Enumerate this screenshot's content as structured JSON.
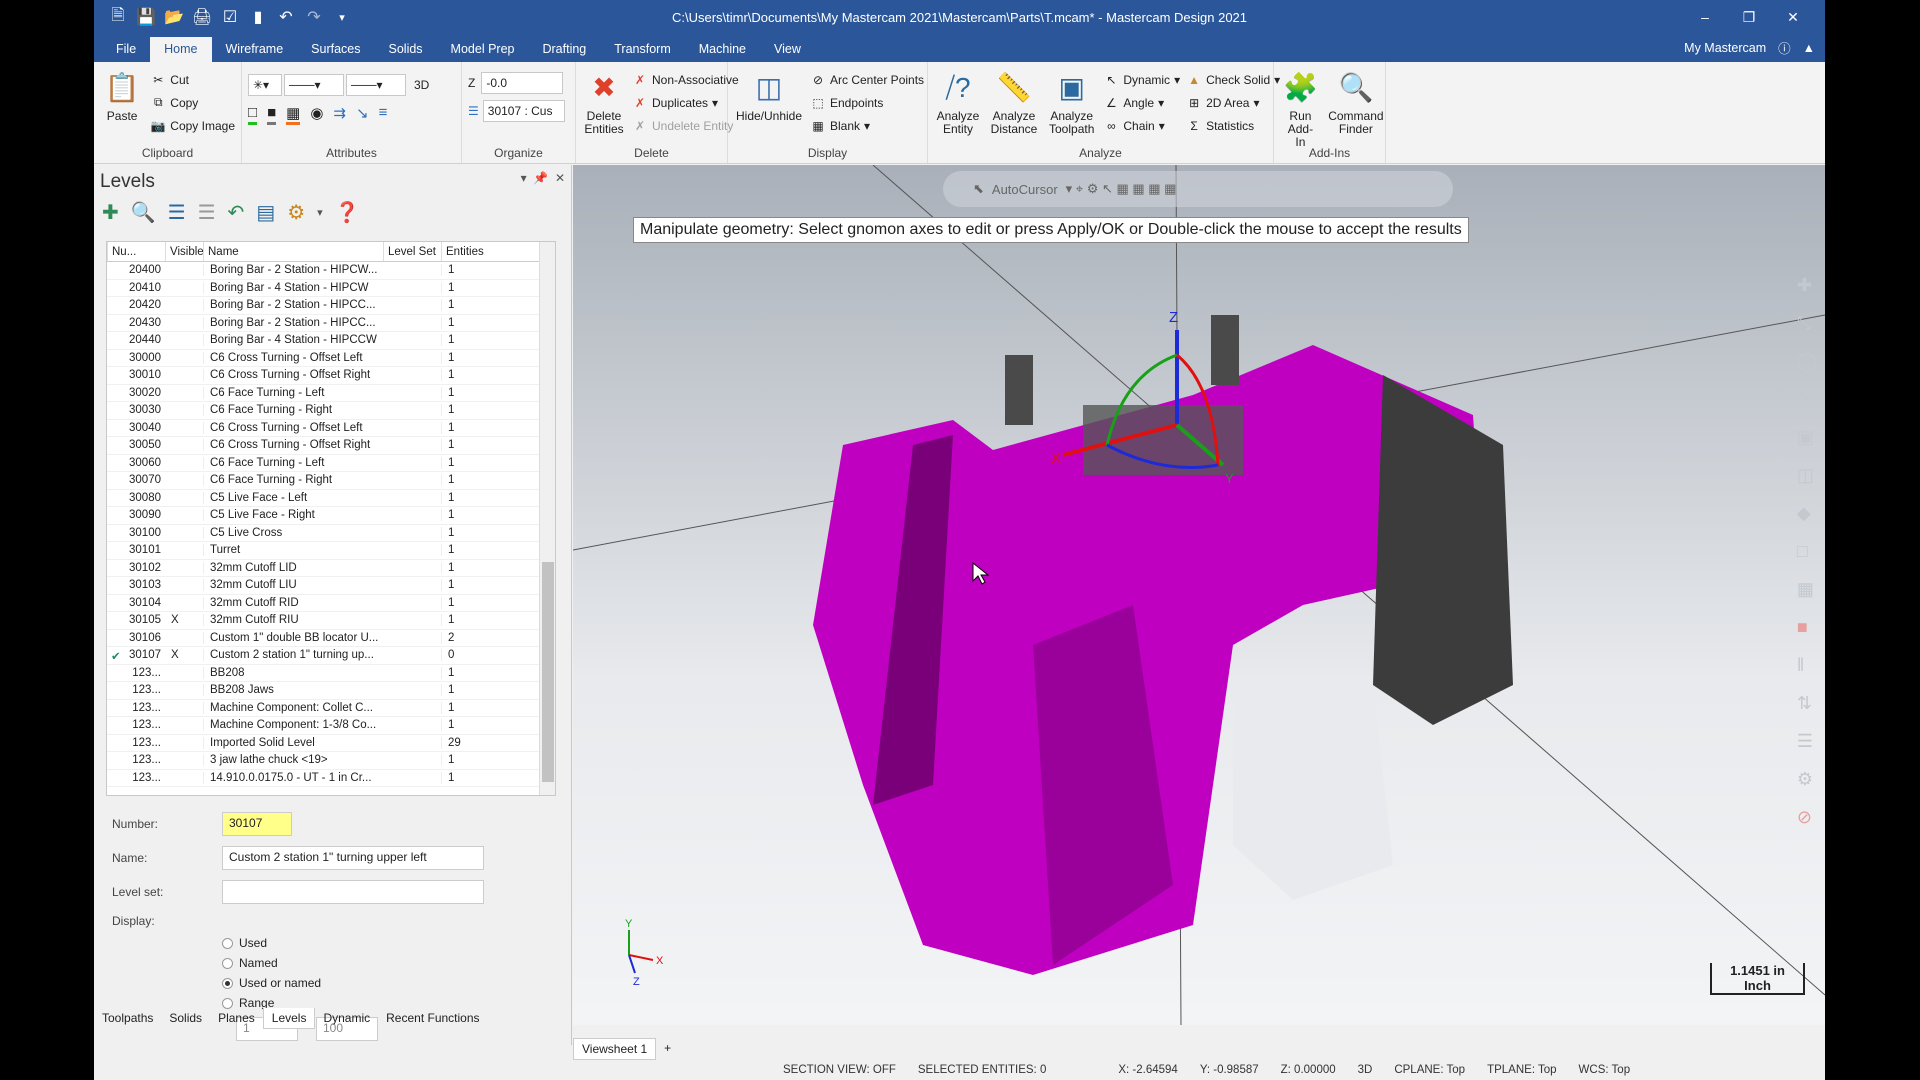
{
  "titlebar": {
    "title": "C:\\Users\\timr\\Documents\\My Mastercam 2021\\Mastercam\\Parts\\T.mcam* - Mastercam Design 2021",
    "qat_icons": [
      "new-file-icon",
      "save-icon",
      "open-icon",
      "print-icon",
      "save-as-icon",
      "bookmark-icon",
      "undo-icon",
      "redo-icon",
      "customize-icon"
    ],
    "controls": {
      "minimize": "–",
      "restore": "❐",
      "close": "✕"
    }
  },
  "tabs": [
    "File",
    "Home",
    "Wireframe",
    "Surfaces",
    "Solids",
    "Model Prep",
    "Drafting",
    "Transform",
    "Machine",
    "View"
  ],
  "active_tab": "Home",
  "my_mastercam": "My Mastercam",
  "ribbon": {
    "clipboard": {
      "label": "Clipboard",
      "paste": "Paste",
      "cut": "Cut",
      "copy": "Copy",
      "copy_image": "Copy Image"
    },
    "attributes": {
      "label": "Attributes",
      "mode": "3D"
    },
    "organize": {
      "label": "Organize",
      "z_label": "Z",
      "z_value": "-0.0",
      "level_value": "30107 : Cus"
    },
    "delete": {
      "label": "Delete",
      "delete_entities": "Delete Entities",
      "non_associative": "Non-Associative",
      "duplicates": "Duplicates",
      "undelete": "Undelete Entity"
    },
    "display": {
      "label": "Display",
      "hide_unhide": "Hide/Unhide",
      "arc_center": "Arc Center Points",
      "endpoints": "Endpoints",
      "blank": "Blank"
    },
    "analyze": {
      "label": "Analyze",
      "entity": "Analyze Entity",
      "distance": "Analyze Distance",
      "toolpath": "Analyze Toolpath",
      "dynamic": "Dynamic",
      "angle": "Angle",
      "chain": "Chain",
      "check_solid": "Check Solid",
      "area2d": "2D Area",
      "statistics": "Statistics"
    },
    "addins": {
      "label": "Add-Ins",
      "run": "Run Add-In",
      "finder": "Command Finder"
    }
  },
  "levels": {
    "title": "Levels",
    "columns": [
      "Nu...",
      "Visible",
      "Name",
      "Level Set",
      "Entities"
    ],
    "rows": [
      {
        "num": "20400",
        "vis": "",
        "name": "Boring Bar - 2 Station - HIPCW...",
        "ent": "1"
      },
      {
        "num": "20410",
        "vis": "",
        "name": "Boring Bar - 4 Station - HIPCW",
        "ent": "1"
      },
      {
        "num": "20420",
        "vis": "",
        "name": "Boring Bar - 2 Station - HIPCC...",
        "ent": "1"
      },
      {
        "num": "20430",
        "vis": "",
        "name": "Boring Bar - 2 Station - HIPCC...",
        "ent": "1"
      },
      {
        "num": "20440",
        "vis": "",
        "name": "Boring Bar - 4 Station - HIPCCW",
        "ent": "1"
      },
      {
        "num": "30000",
        "vis": "",
        "name": "C6 Cross Turning - Offset Left",
        "ent": "1"
      },
      {
        "num": "30010",
        "vis": "",
        "name": "C6 Cross Turning - Offset Right",
        "ent": "1"
      },
      {
        "num": "30020",
        "vis": "",
        "name": "C6 Face Turning - Left",
        "ent": "1"
      },
      {
        "num": "30030",
        "vis": "",
        "name": "C6 Face Turning - Right",
        "ent": "1"
      },
      {
        "num": "30040",
        "vis": "",
        "name": "C6 Cross Turning - Offset Left",
        "ent": "1"
      },
      {
        "num": "30050",
        "vis": "",
        "name": "C6 Cross Turning - Offset Right",
        "ent": "1"
      },
      {
        "num": "30060",
        "vis": "",
        "name": "C6 Face Turning - Left",
        "ent": "1"
      },
      {
        "num": "30070",
        "vis": "",
        "name": "C6 Face Turning - Right",
        "ent": "1"
      },
      {
        "num": "30080",
        "vis": "",
        "name": "C5 Live Face - Left",
        "ent": "1"
      },
      {
        "num": "30090",
        "vis": "",
        "name": "C5 Live Face - Right",
        "ent": "1"
      },
      {
        "num": "30100",
        "vis": "",
        "name": "C5 Live Cross",
        "ent": "1"
      },
      {
        "num": "30101",
        "vis": "",
        "name": "Turret",
        "ent": "1"
      },
      {
        "num": "30102",
        "vis": "",
        "name": "32mm Cutoff LID",
        "ent": "1"
      },
      {
        "num": "30103",
        "vis": "",
        "name": "32mm Cutoff LIU",
        "ent": "1"
      },
      {
        "num": "30104",
        "vis": "",
        "name": "32mm Cutoff RID",
        "ent": "1"
      },
      {
        "num": "30105",
        "vis": "X",
        "name": "32mm Cutoff RIU",
        "ent": "1"
      },
      {
        "num": "30106",
        "vis": "",
        "name": "Custom 1\" double BB locator U...",
        "ent": "2"
      },
      {
        "num": "30107",
        "vis": "X",
        "name": "Custom 2 station 1\" turning up...",
        "ent": "0",
        "current": true
      },
      {
        "num": "123...",
        "vis": "",
        "name": "BB208",
        "ent": "1"
      },
      {
        "num": "123...",
        "vis": "",
        "name": "BB208 Jaws",
        "ent": "1"
      },
      {
        "num": "123...",
        "vis": "",
        "name": "Machine Component: Collet C...",
        "ent": "1"
      },
      {
        "num": "123...",
        "vis": "",
        "name": "Machine Component: 1-3/8 Co...",
        "ent": "1"
      },
      {
        "num": "123...",
        "vis": "",
        "name": "Imported Solid Level",
        "ent": "29"
      },
      {
        "num": "123...",
        "vis": "",
        "name": "3 jaw lathe chuck  <19>",
        "ent": "1"
      },
      {
        "num": "123...",
        "vis": "",
        "name": "14.910.0.0175.0 - UT - 1 in Cr...",
        "ent": "1"
      }
    ],
    "props": {
      "number_label": "Number:",
      "number": "30107",
      "name_label": "Name:",
      "name": "Custom 2 station 1\" turning upper left",
      "levelset_label": "Level set:",
      "levelset": "",
      "display_label": "Display:",
      "options": [
        "Used",
        "Named",
        "Used or named",
        "Range"
      ],
      "selected": "Used or named",
      "range_from": "1",
      "range_to": "100"
    }
  },
  "panel_tabs": [
    "Toolpaths",
    "Solids",
    "Planes",
    "Levels",
    "Dynamic",
    "Recent Functions"
  ],
  "active_panel_tab": "Levels",
  "viewport": {
    "prompt": "Manipulate geometry: Select gnomon axes to edit or press Apply/OK or Double-click the mouse to accept the results",
    "autocursor": "AutoCursor",
    "scale_value": "1.1451 in",
    "scale_unit": "Inch"
  },
  "viewsheet_tabs": [
    "Viewsheet 1",
    "+"
  ],
  "status": {
    "section": "SECTION VIEW: OFF",
    "selected": "SELECTED ENTITIES: 0",
    "x": "X:  -2.64594",
    "y": "Y:  -0.98587",
    "z": "Z:  0.00000",
    "mode": "3D",
    "cplane": "CPLANE: Top",
    "tplane": "TPLANE: Top",
    "wcs": "WCS: Top"
  },
  "colors": {
    "accent": "#2b579a",
    "model": "#c000c0",
    "model_dark": "#3c3c3c"
  }
}
